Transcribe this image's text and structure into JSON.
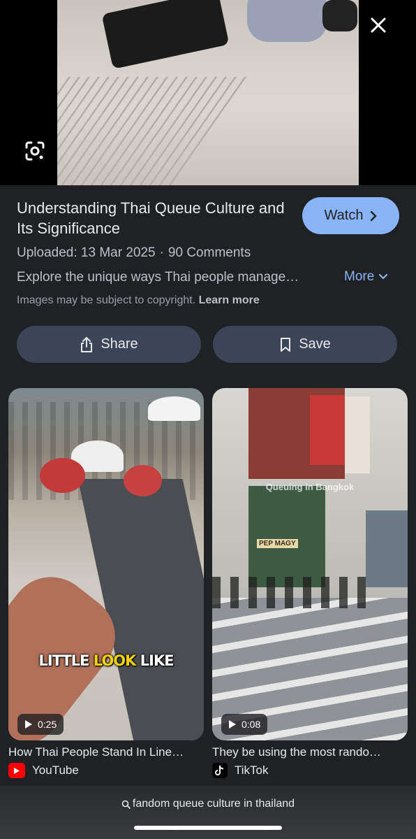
{
  "hero": {
    "close_icon": "close-icon",
    "lens_icon": "google-lens-icon"
  },
  "result": {
    "title": "Understanding Thai Queue Culture and Its Significance",
    "watch_label": "Watch",
    "uploaded": "Uploaded: 13 Mar 2025",
    "separator": "·",
    "comments": "90 Comments",
    "description": "Explore the unique ways Thai people manage…",
    "more_label": "More",
    "copyright_text": "Images may be subject to copyright.",
    "learn_more": "Learn more",
    "share_label": "Share",
    "save_label": "Save"
  },
  "cards": [
    {
      "duration": "0:25",
      "title": "How Thai People Stand In Line…",
      "source": "YouTube",
      "caption_pre": "LITTLE ",
      "caption_hl": "LOOK",
      "caption_post": " LIKE"
    },
    {
      "duration": "0:08",
      "title": "They be using the most rando…",
      "source": "TikTok",
      "watermark": "Queuing in Bangkok",
      "storefront": "PEP MAGY"
    }
  ],
  "search": {
    "query": "fandom queue culture in thailand"
  },
  "colors": {
    "accent": "#8ab4f8",
    "background": "#202124",
    "chip": "#3c4458"
  }
}
